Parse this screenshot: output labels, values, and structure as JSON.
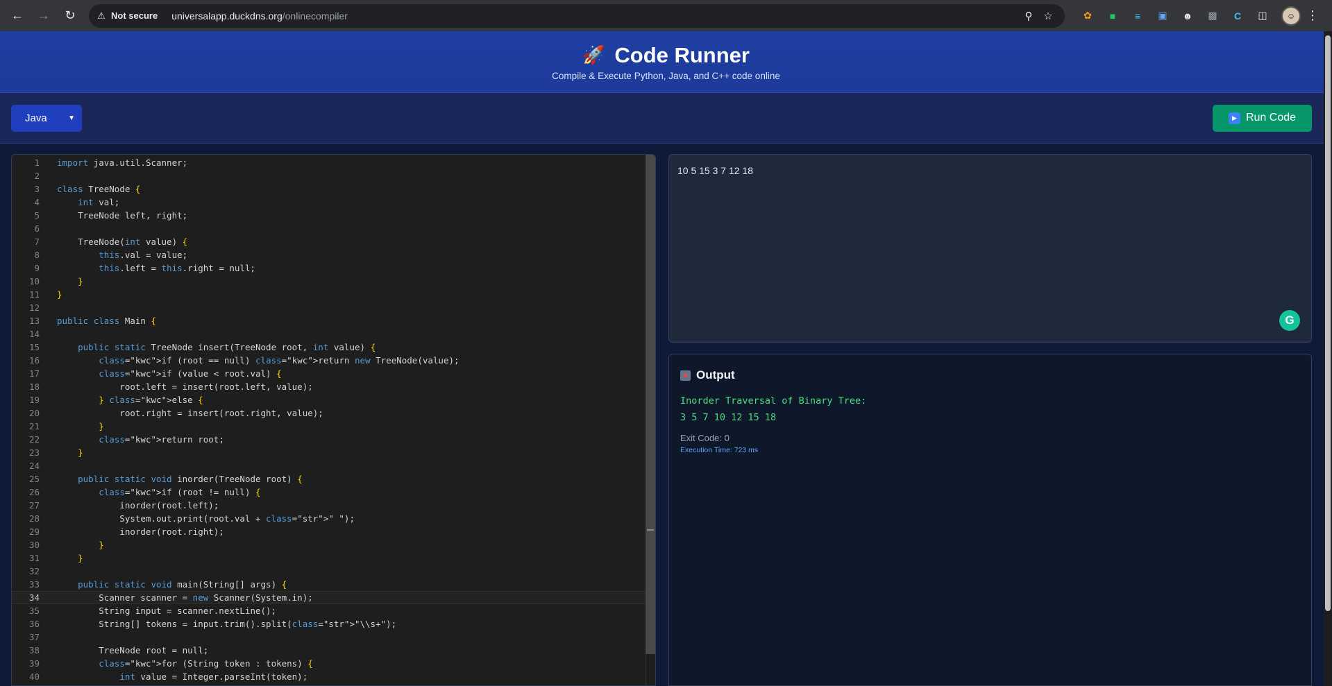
{
  "browser": {
    "not_secure": "Not secure",
    "url_host": "universalapp.duckdns.org",
    "url_path": "/onlinecompiler"
  },
  "header": {
    "title": "Code Runner",
    "subtitle": "Compile & Execute Python, Java, and C++ code online"
  },
  "toolbar": {
    "language": "Java",
    "run_label": "Run Code"
  },
  "editor": {
    "active_line": 34,
    "lines": [
      "import java.util.Scanner;",
      "",
      "class TreeNode {",
      "    int val;",
      "    TreeNode left, right;",
      "",
      "    TreeNode(int value) {",
      "        this.val = value;",
      "        this.left = this.right = null;",
      "    }",
      "}",
      "",
      "public class Main {",
      "",
      "    public static TreeNode insert(TreeNode root, int value) {",
      "        if (root == null) return new TreeNode(value);",
      "        if (value < root.val) {",
      "            root.left = insert(root.left, value);",
      "        } else {",
      "            root.right = insert(root.right, value);",
      "        }",
      "        return root;",
      "    }",
      "",
      "    public static void inorder(TreeNode root) {",
      "        if (root != null) {",
      "            inorder(root.left);",
      "            System.out.print(root.val + \" \");",
      "            inorder(root.right);",
      "        }",
      "    }",
      "",
      "    public static void main(String[] args) {",
      "        Scanner scanner = new Scanner(System.in);",
      "        String input = scanner.nextLine();",
      "        String[] tokens = input.trim().split(\"\\\\s+\");",
      "",
      "        TreeNode root = null;",
      "        for (String token : tokens) {",
      "            int value = Integer.parseInt(token);"
    ]
  },
  "input": {
    "value": "10 5 15 3 7 12 18"
  },
  "output": {
    "heading": "Output",
    "lines": [
      "Inorder Traversal of Binary Tree:",
      "3 5 7 10 12 15 18"
    ],
    "exit_code": "Exit Code: 0",
    "execution_time": "Execution Time: 723 ms"
  }
}
